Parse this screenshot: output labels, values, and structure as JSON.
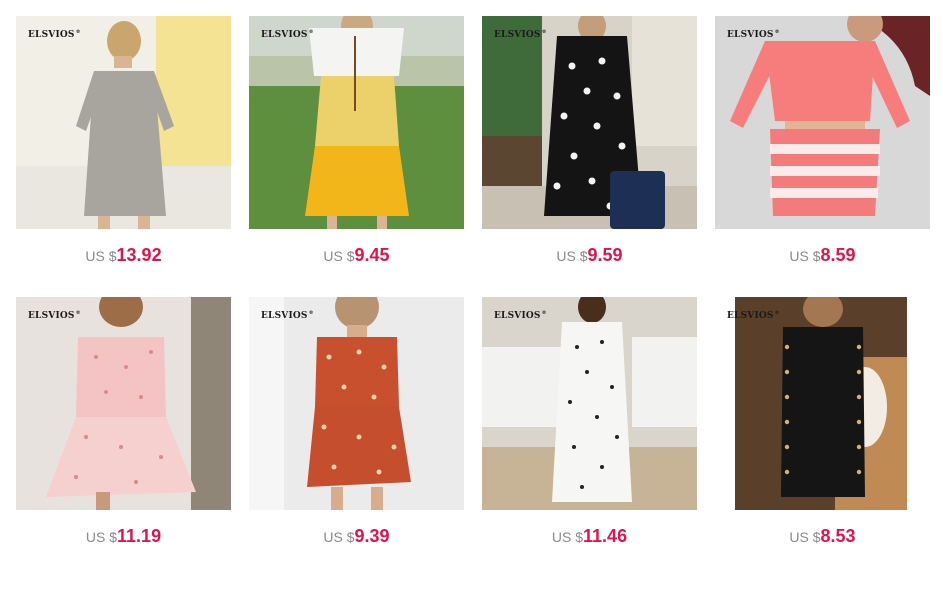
{
  "products": [
    {
      "brand": "ELSVIOS",
      "currency": "US $",
      "amount": "13.92"
    },
    {
      "brand": "ELSVIOS",
      "currency": "US $",
      "amount": "9.45"
    },
    {
      "brand": "ELSVIOS",
      "currency": "US $",
      "amount": "9.59"
    },
    {
      "brand": "ELSVIOS",
      "currency": "US $",
      "amount": "8.59"
    },
    {
      "brand": "ELSVIOS",
      "currency": "US $",
      "amount": "11.19"
    },
    {
      "brand": "ELSVIOS",
      "currency": "US $",
      "amount": "9.39"
    },
    {
      "brand": "ELSVIOS",
      "currency": "US $",
      "amount": "11.46"
    },
    {
      "brand": "ELSVIOS",
      "currency": "US $",
      "amount": "8.53"
    }
  ],
  "colors": {
    "price": "#e0144c",
    "currency": "#8a8a8a"
  }
}
